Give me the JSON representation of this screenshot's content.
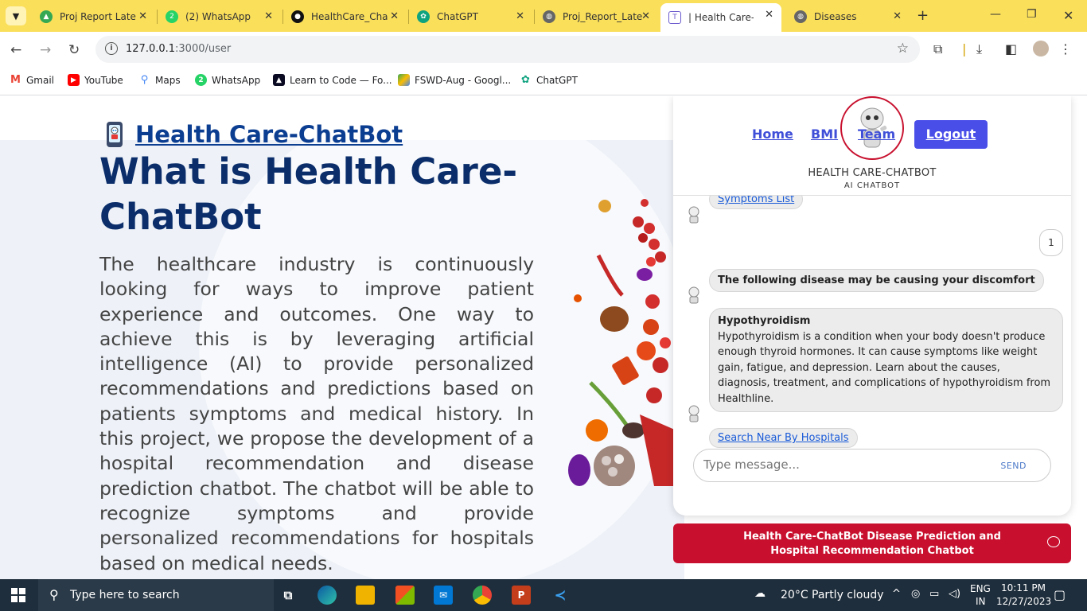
{
  "browser": {
    "tabs": [
      {
        "title": "Proj Report Late",
        "icon": "google-drive-icon",
        "color": "#34a853"
      },
      {
        "title": "(2) WhatsApp",
        "icon": "whatsapp-icon",
        "color": "#25d366"
      },
      {
        "title": "HealthCare_Cha",
        "icon": "github-icon",
        "color": "#111"
      },
      {
        "title": "ChatGPT",
        "icon": "chatgpt-icon",
        "color": "#10a37f"
      },
      {
        "title": "Proj_Report_Late",
        "icon": "globe-icon",
        "color": "#555"
      },
      {
        "title": "| Health Care-Ch",
        "icon": "page-icon",
        "color": "#6a5acd",
        "active": true
      },
      {
        "title": "Diseases",
        "icon": "globe-icon",
        "color": "#555"
      }
    ],
    "address": {
      "host": "127.0.0.1",
      "path": ":3000/user"
    },
    "bookmarks": [
      {
        "label": "Gmail",
        "icon": "gmail-icon",
        "color": "#ea4335"
      },
      {
        "label": "YouTube",
        "icon": "youtube-icon",
        "color": "#ff0000"
      },
      {
        "label": "Maps",
        "icon": "maps-icon",
        "color": "#4285f4"
      },
      {
        "label": "WhatsApp",
        "icon": "whatsapp-icon",
        "color": "#25d366"
      },
      {
        "label": "Learn to Code — Fo...",
        "icon": "freecodecamp-icon",
        "color": "#0a0a23"
      },
      {
        "label": "FSWD-Aug - Googl...",
        "icon": "google-drive-icon",
        "color": "#fbbc04"
      },
      {
        "label": "ChatGPT",
        "icon": "chatgpt-icon",
        "color": "#10a37f"
      }
    ]
  },
  "page": {
    "brand": "Health Care-ChatBot",
    "title": "What is Health Care-ChatBot",
    "paragraph": "The healthcare industry is continuously looking for ways to improve patient experience and outcomes. One way to achieve this is by leveraging artificial intelligence (AI) to provide personalized recommendations and predictions based on patients symptoms and medical history. In this project, we propose the development of a hospital recommendation and disease prediction chatbot. The chatbot will be able to recognize symptoms and provide personalized recommendations for hospitals based on medical needs."
  },
  "chat": {
    "nav": {
      "home": "Home",
      "bmi": "BMI",
      "team": "Team",
      "logout": "Logout"
    },
    "name": "HEALTH CARE-CHATBOT",
    "subtitle": "AI CHATBOT",
    "messages": {
      "symptoms_link": "Symptoms List",
      "user_reply": "1",
      "disease_intro": "The following disease may be causing your discomfort",
      "disease_name": "Hypothyroidism",
      "disease_desc": "Hypothyroidism is a condition when your body doesn't produce enough thyroid hormones. It can cause symptoms like weight gain, fatigue, and depression. Learn about the causes, diagnosis, treatment, and complications of hypothyroidism from Healthline.",
      "hospitals_link": "Search Near By Hospitals"
    },
    "input_placeholder": "Type message...",
    "send_label": "SEND",
    "banner": "Health Care-ChatBot Disease Prediction and Hospital Recommendation Chatbot"
  },
  "taskbar": {
    "search_placeholder": "Type here to search",
    "weather": "20°C  Partly cloudy",
    "lang": "ENG",
    "region": "IN",
    "time": "10:11 PM",
    "date": "12/27/2023"
  },
  "colors": {
    "tabstrip": "#fadf5b",
    "accent": "#c8102e",
    "logout": "#4a4ee8",
    "title": "#0b2e6b"
  }
}
